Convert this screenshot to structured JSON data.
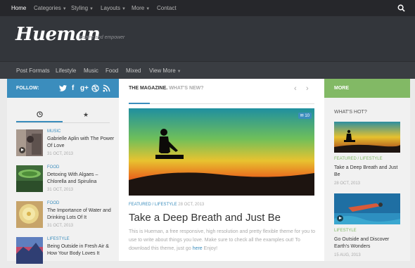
{
  "topnav": {
    "items": [
      "Home",
      "Categories",
      "Styling",
      "Layouts",
      "More",
      "Contact"
    ],
    "active": "Home"
  },
  "header": {
    "logo": "Hueman",
    "tagline": "Inspire and empower"
  },
  "subnav": {
    "items": [
      "Post Formats",
      "Lifestyle",
      "Music",
      "Food",
      "Mixed",
      "View More"
    ]
  },
  "follow": {
    "label": "FOLLOW:",
    "icons": [
      "twitter-icon",
      "facebook-icon",
      "google-plus-icon",
      "dribbble-icon",
      "rss-icon"
    ]
  },
  "more": {
    "label": "MORE"
  },
  "colors": {
    "blue": "#3b8dbd",
    "green": "#82b965",
    "dark": "#26272b"
  },
  "sidebar": {
    "tabs": [
      "clock-icon",
      "star-icon"
    ],
    "posts": [
      {
        "category": "MUSIC",
        "title": "Gabrielle Aplin with The Power Of Love",
        "date": "31 OCT, 2013"
      },
      {
        "category": "FOOD",
        "title": "Detoxing With Algaes – Chlorella and Spirulina",
        "date": "31 OCT, 2013"
      },
      {
        "category": "FOOD",
        "title": "The Importance of Water and Drinking Lots Of It",
        "date": "31 OCT, 2013"
      },
      {
        "category": "LIFESTYLE",
        "title": "Being Outside in Fresh Air & How Your Body Loves It",
        "date": ""
      }
    ]
  },
  "main": {
    "heading": "THE MAGAZINE.",
    "subheading": "WHAT'S NEW?",
    "comment_count": "10",
    "meta_cat": "FEATURED / LIFESTYLE",
    "meta_date": "28 OCT, 2013",
    "title": "Take a Deep Breath and Just Be",
    "excerpt_before": "This is Hueman, a free responsive, high resolution and pretty flexible theme for you to use to write about things you love. Make sure to check all the examples out! To download this theme, just go",
    "excerpt_link": "here",
    "excerpt_after": "Enjoy!"
  },
  "rightcol": {
    "heading": "WHAT'S HOT?",
    "posts": [
      {
        "category": "FEATURED / LIFESTYLE",
        "title": "Take a Deep Breath and Just Be",
        "date": "28 OCT, 2013"
      },
      {
        "category": "LIFESTYLE",
        "title": "Go Outside and Discover Earth's Wonders",
        "date": "15 AUG, 2013"
      }
    ]
  }
}
